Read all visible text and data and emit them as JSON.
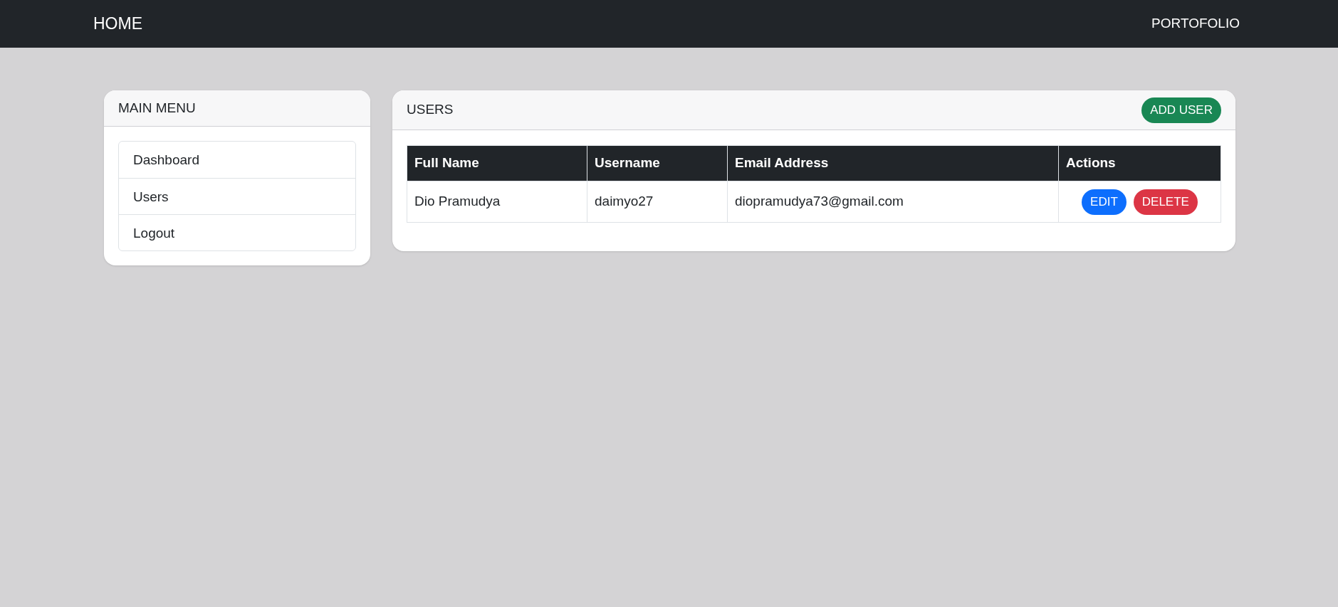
{
  "navbar": {
    "brand": "HOME",
    "link": "PORTOFOLIO"
  },
  "sidebar": {
    "title": "MAIN MENU",
    "items": [
      "Dashboard",
      "Users",
      "Logout"
    ]
  },
  "users": {
    "title": "USERS",
    "add_button": "ADD USER",
    "table": {
      "columns": [
        "Full Name",
        "Username",
        "Email Address",
        "Actions"
      ],
      "rows": [
        {
          "cells": [
            "Dio Pramudya",
            "daimyo27",
            "diopramudya73@gmail.com"
          ],
          "actions": [
            {
              "label": "EDIT",
              "kind": "edit"
            },
            {
              "label": "DELETE",
              "kind": "delete"
            }
          ]
        }
      ]
    }
  }
}
